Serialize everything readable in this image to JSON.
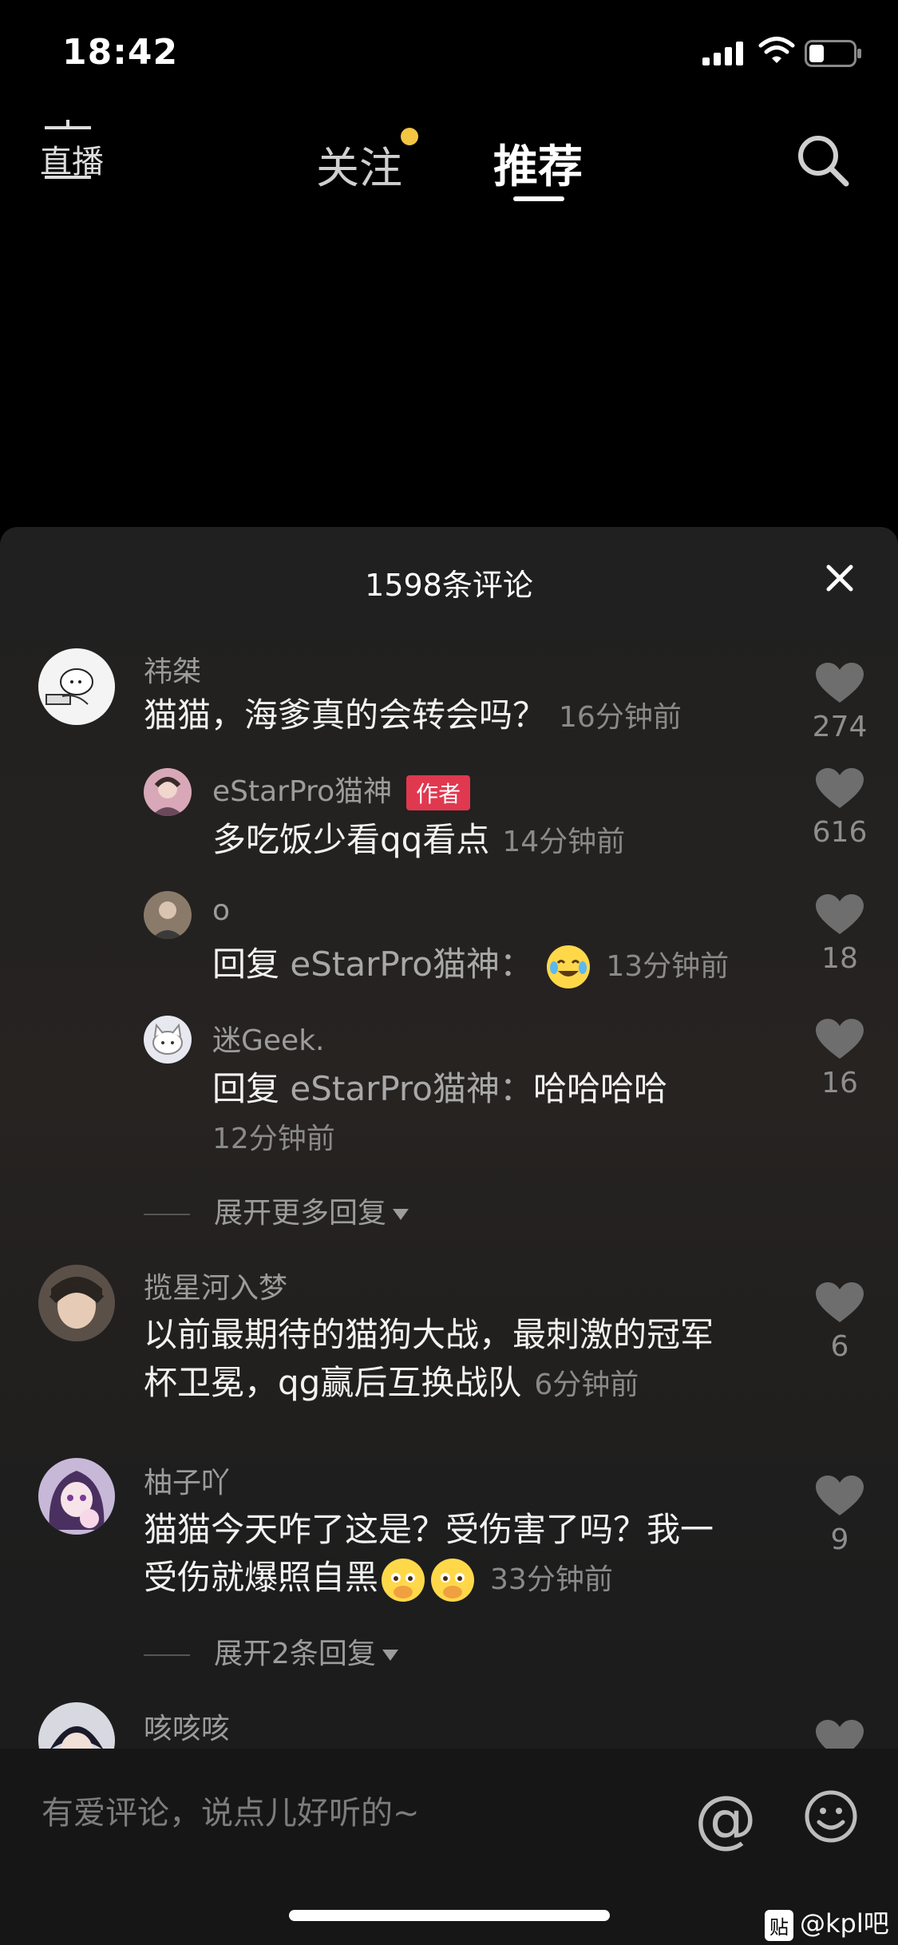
{
  "status": {
    "time": "18:42"
  },
  "nav": {
    "live_label": "直播",
    "tabs": [
      {
        "label": "关注",
        "has_dot": true
      },
      {
        "label": "推荐",
        "active": true
      }
    ]
  },
  "sheet": {
    "title": "1598条评论",
    "comments": [
      {
        "user": "祎桀",
        "text": "猫猫，海爹真的会转会吗？",
        "time": "16分钟前",
        "likes": "274",
        "replies": [
          {
            "user": "eStarPro猫神",
            "badge": "作者",
            "text": "多吃饭少看qq看点",
            "time": "14分钟前",
            "likes": "616"
          },
          {
            "user": "o",
            "prefix": "回复",
            "target": "eStarPro猫神：",
            "text": "",
            "emoji": "laughing-crying-emoji",
            "time": "13分钟前",
            "likes": "18"
          },
          {
            "user": "迷Geek.",
            "prefix": "回复",
            "target": "eStarPro猫神：",
            "text": "哈哈哈哈",
            "time": "12分钟前",
            "likes": "16"
          }
        ],
        "expand_label": "展开更多回复"
      },
      {
        "user": "揽星河入梦",
        "text_line1": "以前最期待的猫狗大战，最刺激的冠军",
        "text_line2": "杯卫冕，qg赢后互换战队",
        "time": "6分钟前",
        "likes": "6"
      },
      {
        "user": "柚子吖",
        "text_line1": "猫猫今天咋了这是？受伤害了吗？我一",
        "text_line2": "受伤就爆照自黑",
        "emoji": "pleading-emoji",
        "time": "33分钟前",
        "likes": "9",
        "expand_label": "展开2条回复"
      },
      {
        "user": "咳咳咳"
      }
    ]
  },
  "input": {
    "placeholder": "有爱评论，说点儿好听的~",
    "at_symbol": "@"
  },
  "watermark": {
    "badge": "贴",
    "text": "@kpl吧"
  },
  "colors": {
    "author_badge": "#e0384f",
    "follow_dot": "#f4c542"
  }
}
